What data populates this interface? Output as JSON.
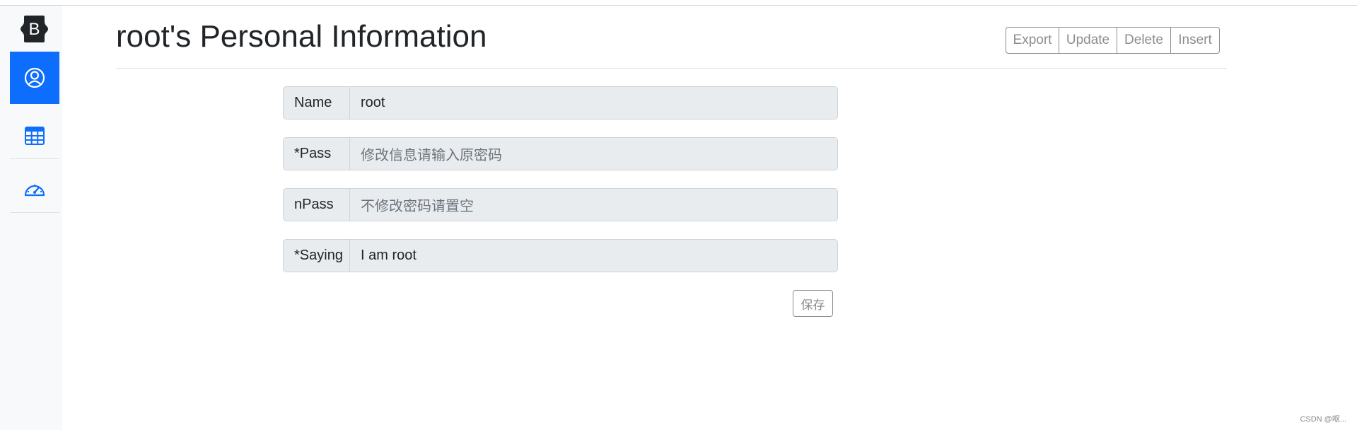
{
  "sidebar": {
    "brand_letter": "B",
    "items": [
      {
        "icon": "person-circle-icon",
        "active": true
      },
      {
        "icon": "table-icon",
        "active": false
      },
      {
        "icon": "speedometer-icon",
        "active": false
      }
    ]
  },
  "header": {
    "title": "root's Personal Information",
    "buttons": {
      "export": "Export",
      "update": "Update",
      "delete": "Delete",
      "insert": "Insert"
    }
  },
  "form": {
    "name": {
      "label": "Name",
      "value": "root",
      "placeholder": ""
    },
    "pass": {
      "label": "*Pass",
      "value": "",
      "placeholder": "修改信息请输入原密码"
    },
    "npass": {
      "label": "nPass",
      "value": "",
      "placeholder": "不修改密码请置空"
    },
    "saying": {
      "label": "*Saying",
      "value": "I am root",
      "placeholder": ""
    },
    "save_label": "保存"
  },
  "watermark": "CSDN @呕...",
  "colors": {
    "accent": "#0d6efd",
    "sidebar_bg": "#f8f9fa",
    "input_bg": "#e9ecef",
    "button_border": "#8d8d8d"
  }
}
